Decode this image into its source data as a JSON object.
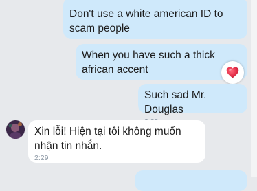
{
  "messages": [
    {
      "id": "msg1",
      "direction": "outgoing",
      "text": "Don't use a white american ID to scam people",
      "time": ""
    },
    {
      "id": "msg2",
      "direction": "outgoing",
      "text": "When you have such a thick african accent",
      "time": ""
    },
    {
      "id": "msg3",
      "direction": "outgoing",
      "text": "Such sad Mr. Douglas",
      "time": "2:29"
    },
    {
      "id": "msg4",
      "direction": "incoming",
      "text": "Xin lỗi! Hiện tại tôi không muốn nhận tin nhắn.",
      "time": "2:29"
    }
  ],
  "reaction": {
    "icon": "heart-icon",
    "color": "#e5304a"
  },
  "colors": {
    "background": "#e7e9ec",
    "outgoing_bubble": "#cfe9fb",
    "incoming_bubble": "#ffffff",
    "timestamp": "#8a96a3"
  }
}
